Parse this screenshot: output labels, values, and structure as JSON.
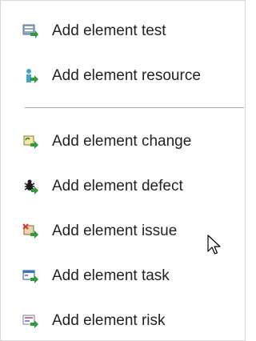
{
  "menu": {
    "items": [
      {
        "label": "Add element test",
        "icon": "test-icon"
      },
      {
        "label": "Add element resource",
        "icon": "resource-icon"
      },
      {
        "label": "Add element change",
        "icon": "change-icon"
      },
      {
        "label": "Add element defect",
        "icon": "defect-bug-icon"
      },
      {
        "label": "Add element issue",
        "icon": "issue-icon"
      },
      {
        "label": "Add element task",
        "icon": "task-icon"
      },
      {
        "label": "Add element risk",
        "icon": "risk-icon"
      }
    ]
  },
  "colors": {
    "text": "#222222",
    "separator": "#a8a8a8",
    "add_arrow": "#2e9a3a",
    "red_mark": "#d23a2a",
    "blue_mark": "#3a72c6"
  }
}
